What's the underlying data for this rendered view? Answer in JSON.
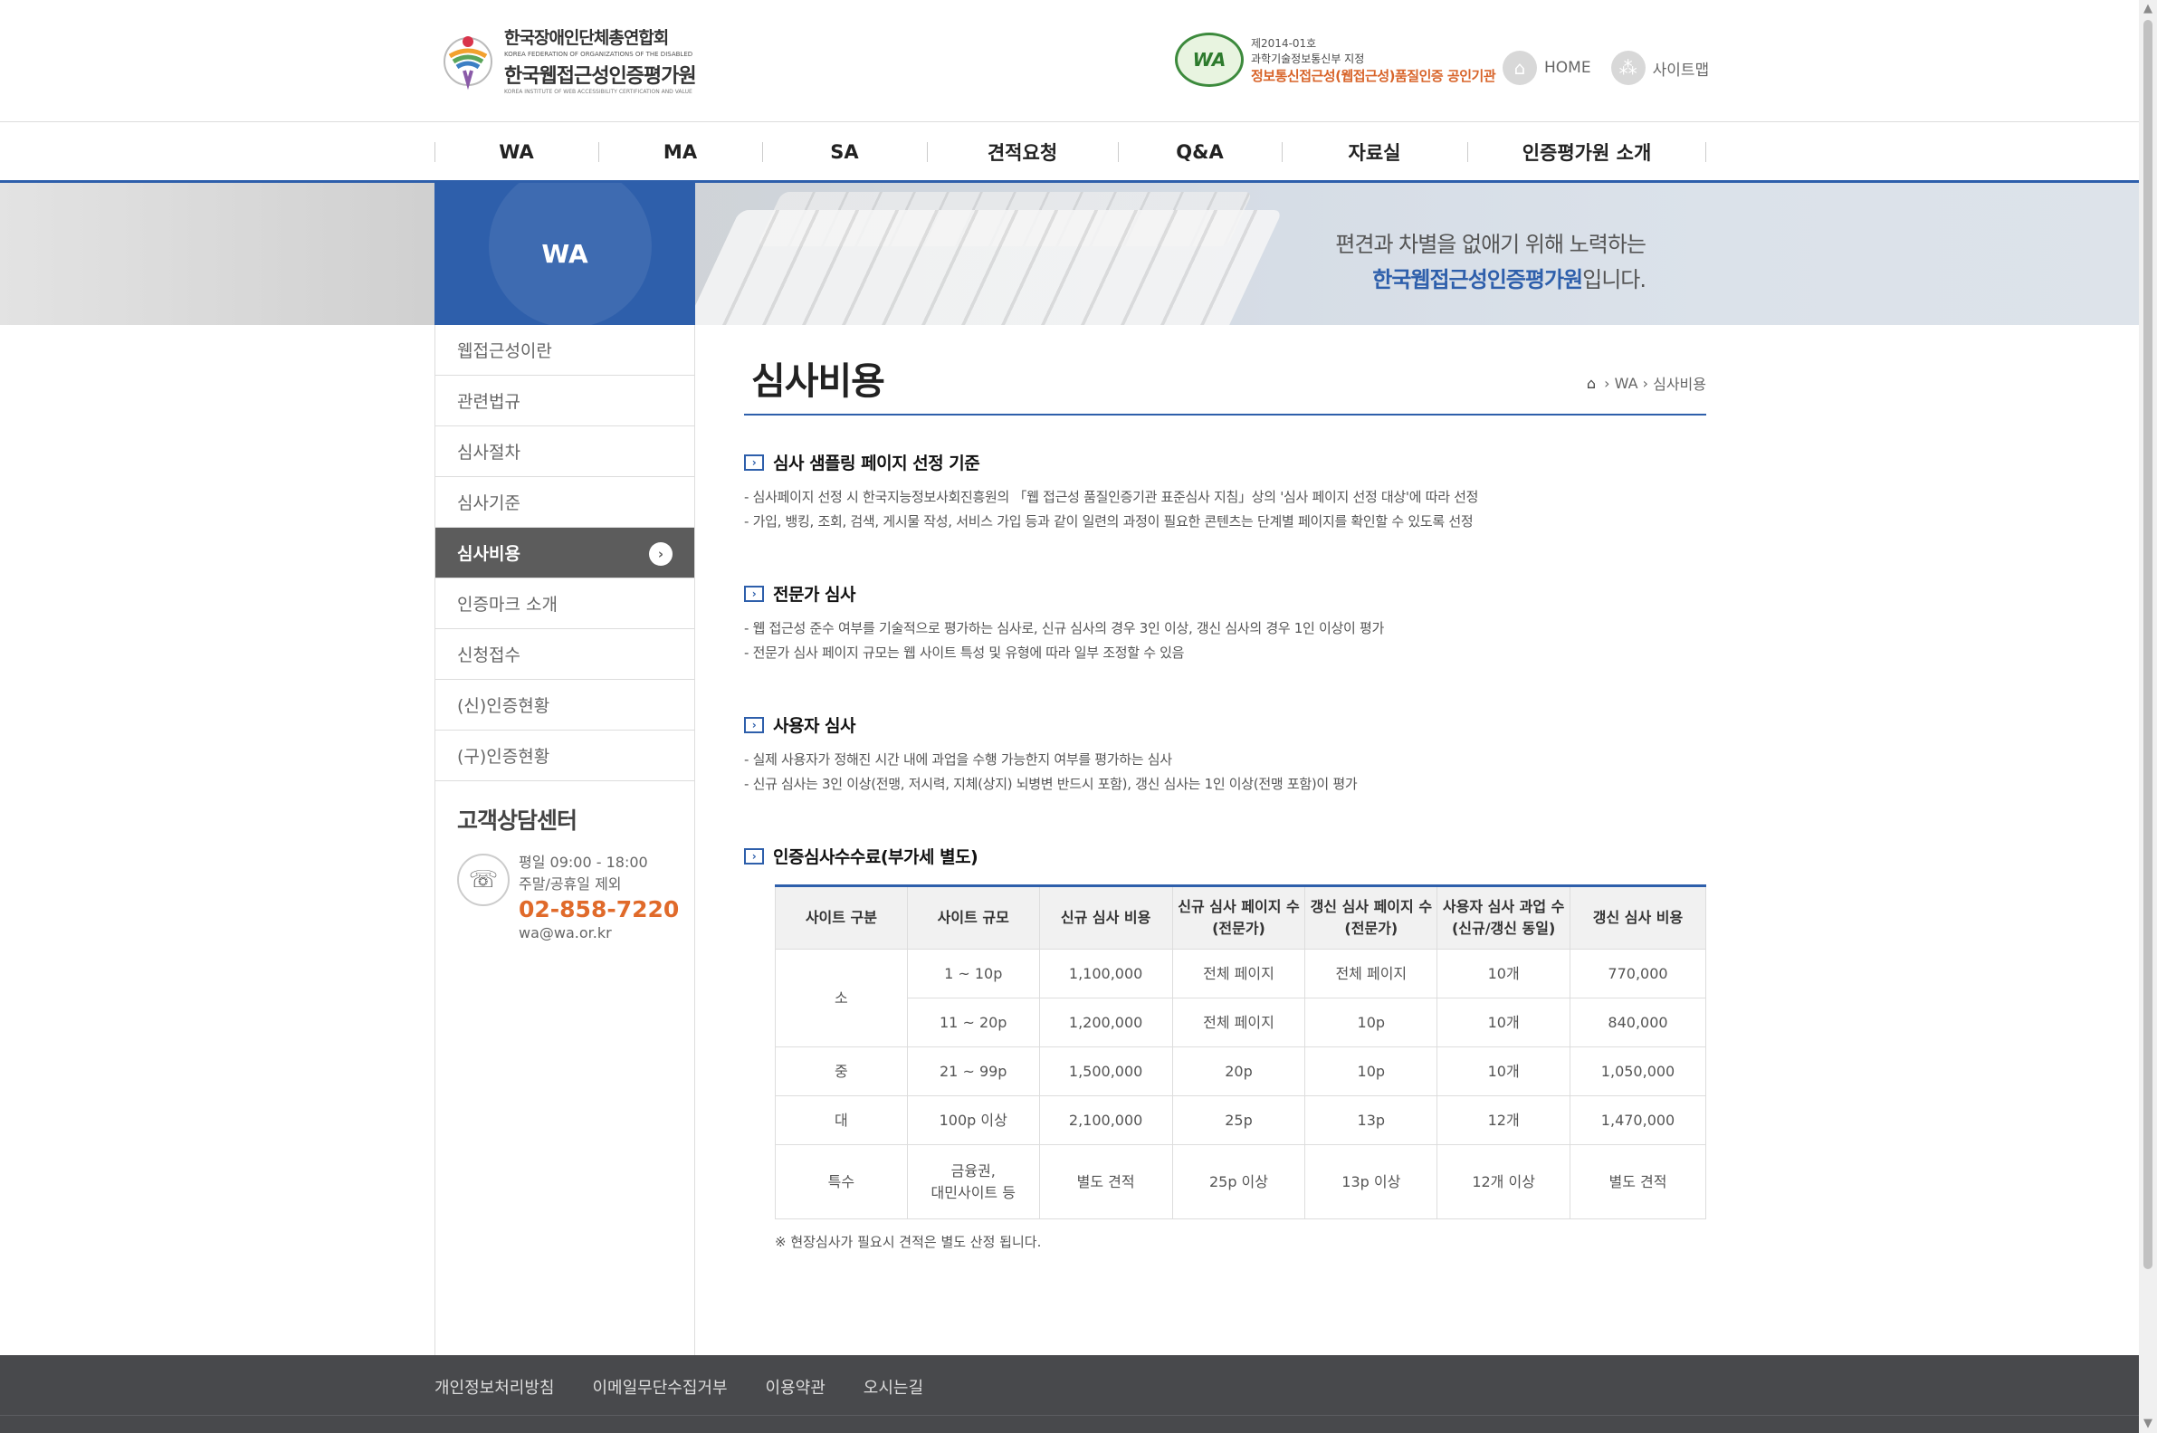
{
  "header": {
    "logo": {
      "line1": "한국장애인단체총연합회",
      "line2": "KOREA FEDERATION OF ORGANIZATIONS OF THE DISABLED",
      "line3": "한국웹접근성인증평가원",
      "line4": "KOREA INSTITUTE OF WEB ACCESSIBILITY CERTIFICATION AND VALUE"
    },
    "cert": {
      "badge": "WA",
      "line1": "제2014-01호",
      "line2": "과학기술정보통신부 지정",
      "line3": "정보통신접근성(웹접근성)품질인증 공인기관"
    },
    "links": [
      {
        "label": "HOME",
        "icon": "home-icon"
      },
      {
        "label": "사이트맵",
        "icon": "sitemap-icon"
      }
    ]
  },
  "nav": [
    "WA",
    "MA",
    "SA",
    "견적요청",
    "Q&A",
    "자료실",
    "인증평가원 소개"
  ],
  "banner": {
    "section": "WA",
    "slogan1": "편견과 차별을 없애기 위해 노력하는",
    "slogan2_strong": "한국웹접근성인증평가원",
    "slogan2_rest": "입니다."
  },
  "sidebar": {
    "items": [
      "웹접근성이란",
      "관련법규",
      "심사절차",
      "심사기준",
      "심사비용",
      "인증마크 소개",
      "신청접수",
      "(신)인증현황",
      "(구)인증현황"
    ],
    "active_index": 4,
    "cs": {
      "title": "고객상담센터",
      "hours": "평일 09:00 - 18:00",
      "closed": "주말/공휴일 제외",
      "tel": "02-858-7220",
      "email": "wa@wa.or.kr"
    }
  },
  "content": {
    "title": "심사비용",
    "breadcrumb": [
      "WA",
      "심사비용"
    ],
    "sections": [
      {
        "heading": "심사 샘플링 페이지 선정 기준",
        "lines": [
          "- 심사페이지 선정 시 한국지능정보사회진흥원의 「웹 접근성 품질인증기관 표준심사 지침」상의 '심사 페이지 선정 대상'에 따라 선정",
          "- 가입, 뱅킹, 조회, 검색, 게시물 작성, 서비스 가입 등과 같이 일련의 과정이 필요한 콘텐츠는 단계별 페이지를 확인할 수 있도록 선정"
        ]
      },
      {
        "heading": "전문가 심사",
        "lines": [
          "- 웹 접근성 준수 여부를 기술적으로 평가하는 심사로, 신규 심사의 경우 3인 이상, 갱신 심사의 경우 1인 이상이 평가",
          "- 전문가 심사 페이지 규모는 웹 사이트 특성 및 유형에 따라 일부 조정할 수 있음"
        ]
      },
      {
        "heading": "사용자 심사",
        "lines": [
          "- 실제 사용자가 정해진 시간 내에 과업을 수행 가능한지 여부를 평가하는 심사",
          "- 신규 심사는 3인 이상(전맹, 저시력, 지체(상지) 뇌병변 반드시 포함), 갱신 심사는 1인 이상(전맹 포함)이 평가"
        ]
      },
      {
        "heading": "인증심사수수료(부가세 별도)"
      }
    ],
    "table": {
      "headers": [
        "사이트 구분",
        "사이트 규모",
        "신규 심사 비용",
        "신규 심사 페이지 수 (전문가)",
        "갱신 심사 페이지 수 (전문가)",
        "사용자 심사 과업 수 (신규/갱신 동일)",
        "갱신 심사 비용"
      ],
      "header_lines": [
        [
          "사이트 구분"
        ],
        [
          "사이트 규모"
        ],
        [
          "신규 심사 비용"
        ],
        [
          "신규 심사 페이지 수",
          "(전문가)"
        ],
        [
          "갱신 심사 페이지 수",
          "(전문가)"
        ],
        [
          "사용자 심사 과업 수",
          "(신규/갱신 동일)"
        ],
        [
          "갱신 심사 비용"
        ]
      ],
      "rows": [
        {
          "group": "소",
          "size": "1 ~ 10p",
          "new_cost": "1,100,000",
          "new_pages": "전체 페이지",
          "renew_pages": "전체 페이지",
          "tasks": "10개",
          "renew_cost": "770,000"
        },
        {
          "group": "",
          "size": "11 ~ 20p",
          "new_cost": "1,200,000",
          "new_pages": "전체 페이지",
          "renew_pages": "10p",
          "tasks": "10개",
          "renew_cost": "840,000"
        },
        {
          "group": "중",
          "size": "21 ~ 99p",
          "new_cost": "1,500,000",
          "new_pages": "20p",
          "renew_pages": "10p",
          "tasks": "10개",
          "renew_cost": "1,050,000"
        },
        {
          "group": "대",
          "size": "100p 이상",
          "new_cost": "2,100,000",
          "new_pages": "25p",
          "renew_pages": "13p",
          "tasks": "12개",
          "renew_cost": "1,470,000"
        },
        {
          "group": "특수",
          "size_lines": [
            "금융권,",
            "대민사이트 등"
          ],
          "new_cost": "별도 견적",
          "new_pages": "25p 이상",
          "renew_pages": "13p 이상",
          "tasks": "12개 이상",
          "renew_cost": "별도 견적"
        }
      ]
    },
    "note": "※ 현장심사가 필요시 견적은 별도 산정 됩니다."
  },
  "footer": [
    "개인정보처리방침",
    "이메일무단수집거부",
    "이용약관",
    "오시는길"
  ],
  "colors": {
    "primary": "#2e5fab",
    "accent": "#e06a2a",
    "active": "#5c5c5c",
    "footer": "#48494c"
  }
}
